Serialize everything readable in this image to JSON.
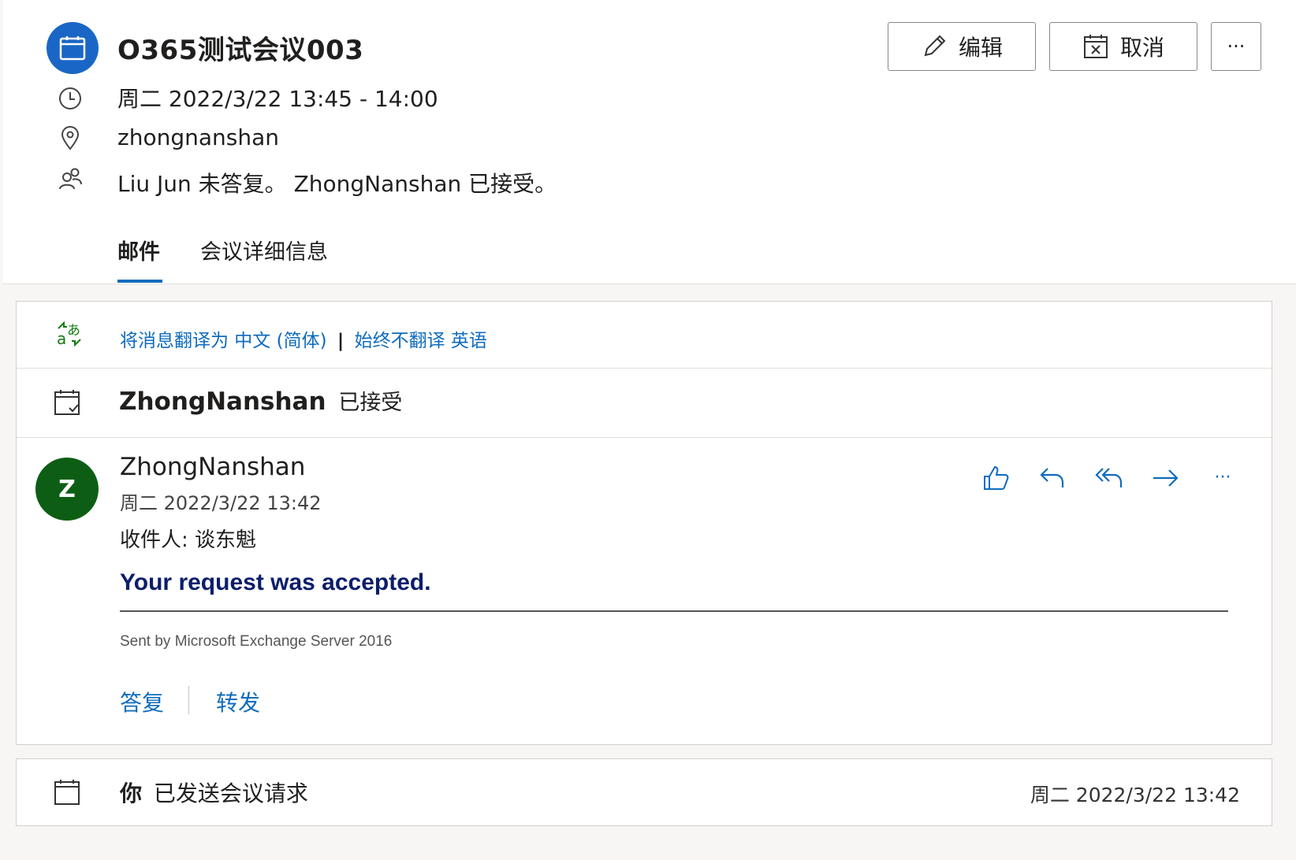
{
  "header": {
    "title": "O365测试会议003",
    "time": "周二 2022/3/22 13:45 - 14:00",
    "location": "zhongnanshan",
    "attendees": "Liu Jun 未答复。 ZhongNanshan 已接受。",
    "buttons": {
      "edit": "编辑",
      "cancel": "取消",
      "more": "···"
    },
    "tabs": [
      "邮件",
      "会议详细信息"
    ]
  },
  "translate_bar": {
    "translate_link": "将消息翻译为 中文 (简体)",
    "separator": "|",
    "never_link": "始终不翻译 英语"
  },
  "response_summary": {
    "name": "ZhongNanshan",
    "status": "已接受"
  },
  "message": {
    "avatar_letter": "Z",
    "sender": "ZhongNanshan",
    "timestamp": "周二 2022/3/22 13:42",
    "recipient": "收件人:  谈东魁",
    "body_heading": "Your request was accepted.",
    "footer": "Sent by Microsoft Exchange Server 2016",
    "reply": "答复",
    "forward": "转发",
    "more": "···"
  },
  "sent_request": {
    "you": "你",
    "text": "已发送会议请求",
    "timestamp": "周二 2022/3/22 13:42"
  },
  "colors": {
    "accent": "#0f6cbd",
    "calendar_circle": "#1a66c6",
    "avatar": "#0d5e14",
    "heading": "#0b1e6b"
  }
}
